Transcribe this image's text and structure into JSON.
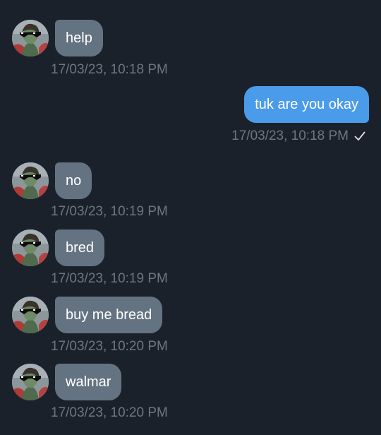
{
  "thread": {
    "messages": [
      {
        "direction": "incoming",
        "text": "help",
        "timestamp": "17/03/23, 10:18 PM"
      },
      {
        "direction": "outgoing",
        "text": "tuk are you okay",
        "timestamp": "17/03/23, 10:18 PM",
        "status_icon": "checkmark-icon"
      },
      {
        "direction": "incoming",
        "text": "no",
        "timestamp": "17/03/23, 10:19 PM"
      },
      {
        "direction": "incoming",
        "text": "bred",
        "timestamp": "17/03/23, 10:19 PM"
      },
      {
        "direction": "incoming",
        "text": "buy me bread",
        "timestamp": "17/03/23, 10:20 PM"
      },
      {
        "direction": "incoming",
        "text": "walmar",
        "timestamp": "17/03/23, 10:20 PM"
      }
    ]
  },
  "colors": {
    "background": "#1b212b",
    "incoming_bubble": "#647382",
    "outgoing_bubble": "#4a9bea",
    "timestamp": "#6c7683"
  }
}
